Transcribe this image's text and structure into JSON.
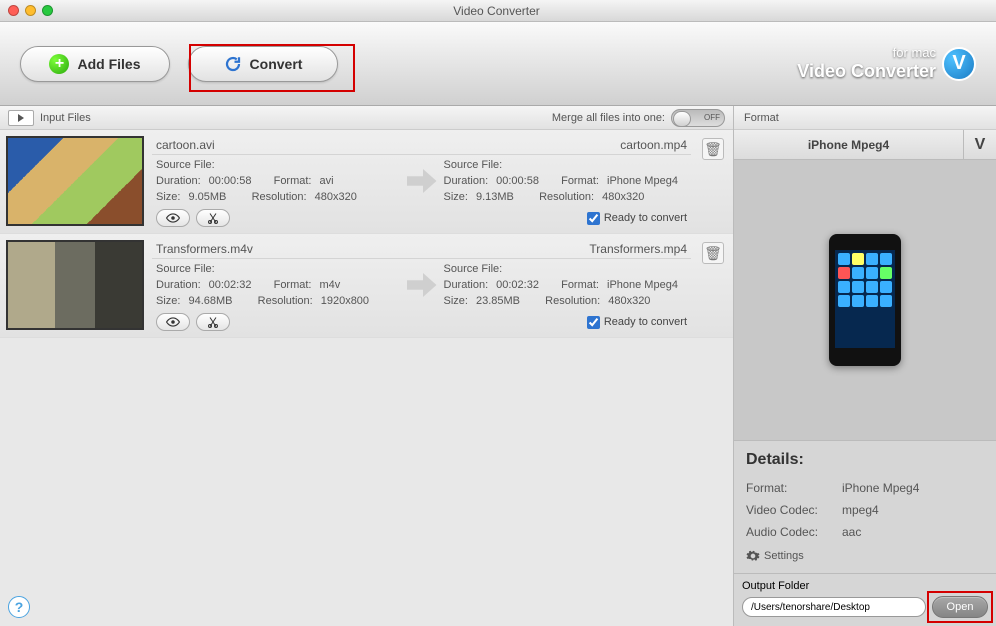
{
  "window": {
    "title": "Video Converter"
  },
  "toolbar": {
    "add_files": "Add Files",
    "convert": "Convert"
  },
  "brand": {
    "line1": "for mac",
    "line2": "Video Converter",
    "logo_letter": "V"
  },
  "input_bar": {
    "label": "Input Files",
    "merge_label": "Merge all files into one:",
    "toggle_text": "OFF"
  },
  "files": [
    {
      "src_name": "cartoon.avi",
      "out_name": "cartoon.mp4",
      "src": {
        "header": "Source File:",
        "duration_label": "Duration:",
        "duration": "00:00:58",
        "format_label": "Format:",
        "format": "avi",
        "size_label": "Size:",
        "size": "9.05MB",
        "res_label": "Resolution:",
        "res": "480x320"
      },
      "dst": {
        "header": "Source File:",
        "duration_label": "Duration:",
        "duration": "00:00:58",
        "format_label": "Format:",
        "format": "iPhone Mpeg4",
        "size_label": "Size:",
        "size": "9.13MB",
        "res_label": "Resolution:",
        "res": "480x320"
      },
      "ready_label": "Ready to convert"
    },
    {
      "src_name": "Transformers.m4v",
      "out_name": "Transformers.mp4",
      "src": {
        "header": "Source File:",
        "duration_label": "Duration:",
        "duration": "00:02:32",
        "format_label": "Format:",
        "format": "m4v",
        "size_label": "Size:",
        "size": "94.68MB",
        "res_label": "Resolution:",
        "res": "1920x800"
      },
      "dst": {
        "header": "Source File:",
        "duration_label": "Duration:",
        "duration": "00:02:32",
        "format_label": "Format:",
        "format": "iPhone Mpeg4",
        "size_label": "Size:",
        "size": "23.85MB",
        "res_label": "Resolution:",
        "res": "480x320"
      },
      "ready_label": "Ready to convert"
    }
  ],
  "format_panel": {
    "header": "Format",
    "selected": "iPhone Mpeg4",
    "v": "V",
    "details_title": "Details:",
    "format_label": "Format:",
    "format_value": "iPhone Mpeg4",
    "vcodec_label": "Video Codec:",
    "vcodec_value": "mpeg4",
    "acodec_label": "Audio Codec:",
    "acodec_value": "aac",
    "settings_label": "Settings"
  },
  "output": {
    "label": "Output Folder",
    "path": "/Users/tenorshare/Desktop",
    "open": "Open"
  },
  "help_glyph": "?"
}
